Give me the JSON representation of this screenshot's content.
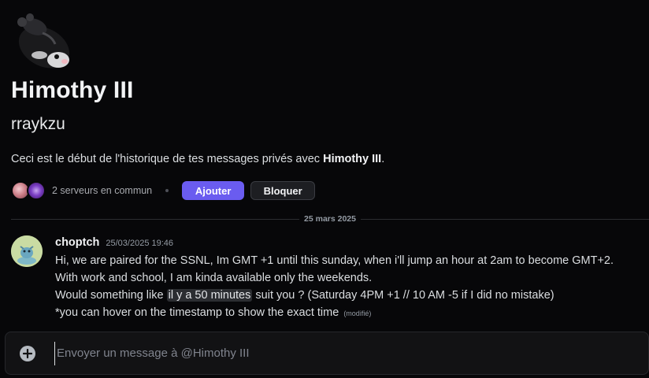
{
  "profile": {
    "display_name": "Himothy III",
    "username": "rraykzu",
    "intro_prefix": "Ceci est le début de l'historique de tes messages privés avec ",
    "intro_name": "Himothy III",
    "intro_suffix": ".",
    "avatar_icon": "hamster-plush-avatar"
  },
  "mutual": {
    "servers_text": "2 serveurs en commun",
    "server_icons": [
      "server-icon-pink",
      "server-icon-purple"
    ]
  },
  "actions": {
    "add_label": "Ajouter",
    "block_label": "Bloquer"
  },
  "divider": {
    "date": "25 mars 2025"
  },
  "message": {
    "author": "choptch",
    "timestamp": "25/03/2025 19:46",
    "line1": "Hi, we are paired for the SSNL, Im GMT +1 until this sunday, when i'll jump an hour at 2am to become GMT+2.",
    "line2": "With work and school, I am kinda available only the weekends.",
    "line3_prefix": "Would something like ",
    "line3_timestamp": "il y a 50 minutes",
    "line3_suffix": " suit you ? (Saturday 4PM +1 // 10 AM -5 if I did no mistake)",
    "line4": "*you can hover on the timestamp to show the exact time",
    "edited": "(modifié)"
  },
  "composer": {
    "placeholder": "Envoyer un message à @Himothy III"
  },
  "colors": {
    "background": "#070709",
    "accent": "#6a5cf0",
    "text": "#dbdee1"
  }
}
